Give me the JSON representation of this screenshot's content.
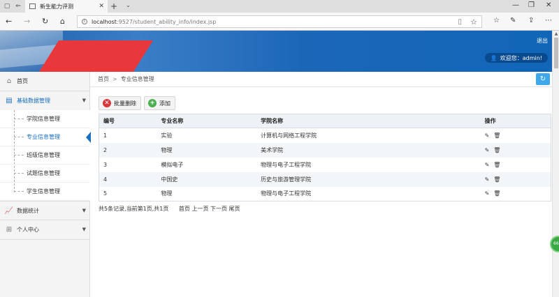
{
  "browser": {
    "tab_title": "新生能力评测",
    "url_host": "localhost",
    "url_path": ":9527/student_ability_info/index.jsp"
  },
  "header": {
    "logout": "退出",
    "welcome": "欢迎您：admin!"
  },
  "sidebar": {
    "home": "首页",
    "basic_data": "基础数据管理",
    "sub_items": [
      "学院信息管理",
      "专业信息管理",
      "班级信息管理",
      "试题信息管理",
      "学生信息管理"
    ],
    "stats": "数据统计",
    "personal": "个人中心"
  },
  "breadcrumb": {
    "home": "首页",
    "separator": ">",
    "current": "专业信息管理"
  },
  "toolbar": {
    "batch_delete": "批量删除",
    "add": "添加"
  },
  "table": {
    "headers": [
      "编号",
      "专业名称",
      "学院名称",
      "操作"
    ],
    "rows": [
      [
        "1",
        "实验",
        "计算机与网络工程学院"
      ],
      [
        "2",
        "物理",
        "美术学院"
      ],
      [
        "3",
        "模拟电子",
        "物理与电子工程学院"
      ],
      [
        "4",
        "中国史",
        "历史与旅游管理学院"
      ],
      [
        "5",
        "物理",
        "物理与电子工程学院"
      ]
    ]
  },
  "pager": {
    "summary": "共5条记录,当前第1页,共1页",
    "first": "首页",
    "prev": "上一页",
    "next": "下一页",
    "last": "尾页"
  },
  "float_badge": "66"
}
